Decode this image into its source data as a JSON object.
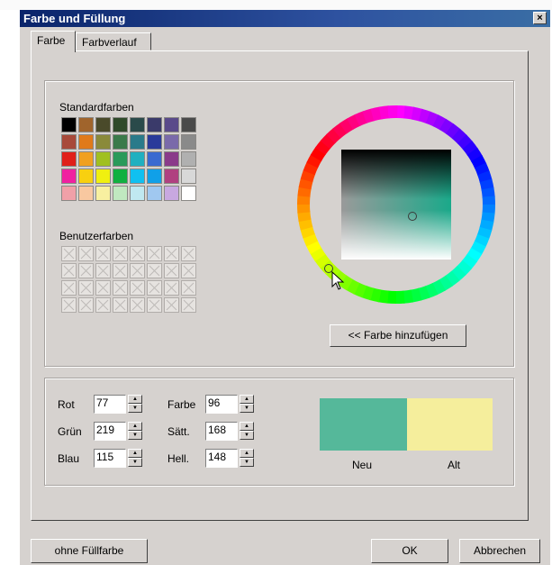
{
  "window": {
    "title": "Farbe und Füllung",
    "close_glyph": "×"
  },
  "tabs": [
    {
      "label": "Farbe",
      "active": true
    },
    {
      "label": "Farbverlauf",
      "active": false
    }
  ],
  "standard": {
    "label": "Standardfarben",
    "colors": [
      "#000000",
      "#a0642c",
      "#4a4a2a",
      "#2f4a2a",
      "#2a4a4a",
      "#3a3a6a",
      "#5a4a8a",
      "#4a4a4a",
      "#a84a3a",
      "#e07a1a",
      "#8a8a3a",
      "#3a7a4a",
      "#2a7a8a",
      "#2a3a9a",
      "#7a6aaa",
      "#8a8a8a",
      "#e0201a",
      "#f0a020",
      "#a0c020",
      "#2a9a5a",
      "#20b0c0",
      "#3a6ad0",
      "#8a3a8a",
      "#b0b0b0",
      "#f020a0",
      "#f8d010",
      "#f0f010",
      "#10b040",
      "#10c0f0",
      "#10a0e8",
      "#b04080",
      "#d8d8d8",
      "#f0a0a8",
      "#f8c8a0",
      "#f8f0a0",
      "#c0e8c0",
      "#c0e8f0",
      "#a0c8f0",
      "#c8a8e0",
      "#ffffff"
    ]
  },
  "custom": {
    "label": "Benutzerfarben"
  },
  "add_button": "<< Farbe hinzufügen",
  "rgb": [
    {
      "label": "Rot",
      "value": "77"
    },
    {
      "label": "Grün",
      "value": "219"
    },
    {
      "label": "Blau",
      "value": "115"
    }
  ],
  "hsl": [
    {
      "label": "Farbe",
      "value": "96"
    },
    {
      "label": "Sätt.",
      "value": "168"
    },
    {
      "label": "Hell.",
      "value": "148"
    }
  ],
  "preview": {
    "new_label": "Neu",
    "old_label": "Alt",
    "new_color": "#55b89a",
    "old_color": "#f5ee9c"
  },
  "buttons": {
    "no_fill": "ohne Füllfarbe",
    "ok": "OK",
    "cancel": "Abbrechen"
  },
  "icons": {
    "close": "close-icon",
    "spin_up": "spin-up-icon",
    "spin_down": "spin-down-icon",
    "cursor": "mouse-pointer-icon"
  }
}
